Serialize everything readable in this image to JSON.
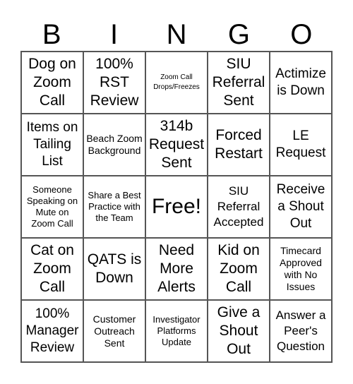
{
  "header": [
    "B",
    "I",
    "N",
    "G",
    "O"
  ],
  "cells": [
    "Dog on Zoom Call",
    "100% RST Review",
    "Zoom Call Drops/Freezes",
    "SIU Referral Sent",
    "Actimize is Down",
    "Items on Tailing List",
    "Beach Zoom Background",
    "314b Request Sent",
    "Forced Restart",
    "LE Request",
    "Someone Speaking on Mute on Zoom Call",
    "Share a Best Practice with the Team",
    "Free!",
    "SIU Referral Accepted",
    "Receive a Shout Out",
    "Cat on Zoom Call",
    "QATS is Down",
    "Need More Alerts",
    "Kid on Zoom Call",
    "Timecard Approved with No Issues",
    "100% Manager Review",
    "Customer Outreach Sent",
    "Investigator Platforms Update",
    "Give a Shout Out",
    "Answer a Peer's Question"
  ]
}
